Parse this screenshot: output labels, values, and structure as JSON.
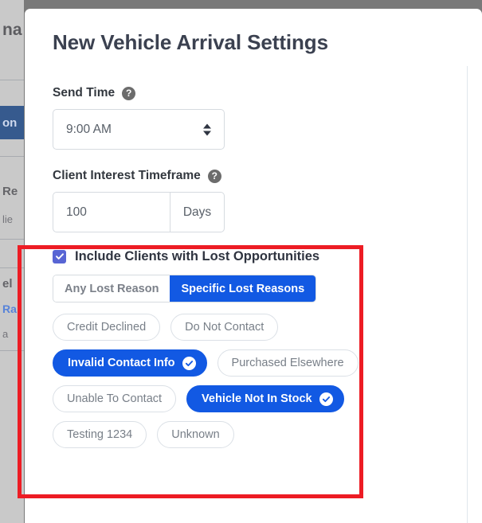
{
  "background": {
    "heading_fragment": "na",
    "nav_selected_fragment": "on",
    "text_fragments": [
      "Re",
      "lie",
      "el",
      "Ra",
      "a"
    ]
  },
  "modal": {
    "title": "New Vehicle Arrival Settings",
    "send_time": {
      "label": "Send Time",
      "help_icon": "help-circle-icon",
      "help_glyph": "?",
      "value": "9:00 AM",
      "spinner_icon": "up-down-arrows-icon"
    },
    "client_interest_timeframe": {
      "label": "Client Interest Timeframe",
      "help_icon": "help-circle-icon",
      "help_glyph": "?",
      "value": "100",
      "placeholder": "100",
      "unit": "Days"
    },
    "lost_opportunities": {
      "checkbox_icon": "checkmark-icon",
      "checkbox_checked": true,
      "label": "Include Clients with Lost Opportunities",
      "segments": [
        {
          "label": "Any Lost Reason",
          "active": false
        },
        {
          "label": "Specific Lost Reasons",
          "active": true
        }
      ],
      "chip_rows": [
        [
          {
            "label": "Credit Declined",
            "selected": false
          },
          {
            "label": "Do Not Contact",
            "selected": false
          }
        ],
        [
          {
            "label": "Invalid Contact Info",
            "selected": true
          },
          {
            "label": "Purchased Elsewhere",
            "selected": false
          }
        ],
        [
          {
            "label": "Unable To Contact",
            "selected": false
          },
          {
            "label": "Vehicle Not In Stock",
            "selected": true
          }
        ],
        [
          {
            "label": "Testing 1234",
            "selected": false
          },
          {
            "label": "Unknown",
            "selected": false
          }
        ]
      ],
      "chip_selected_icon": "check-circle-icon"
    }
  },
  "colors": {
    "accent_blue": "#1259e3",
    "checkbox_indigo": "#5865d4",
    "highlight_red": "#ed1c24",
    "backdrop_gray": "#797979",
    "text_dark": "#3b4150",
    "text_muted": "#787f88"
  }
}
